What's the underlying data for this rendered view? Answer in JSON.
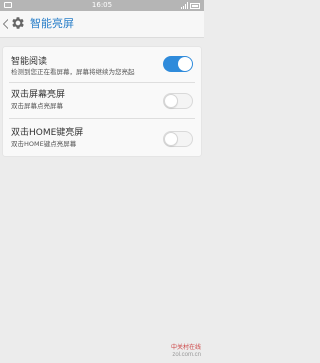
{
  "status_bar": {
    "time": "16:05"
  },
  "header": {
    "title": "智能亮屏"
  },
  "settings": [
    {
      "title": "智能阅读",
      "subtitle": "检测到您正在看屏幕，屏幕将继续为您亮起",
      "enabled": true
    },
    {
      "title": "双击屏幕亮屏",
      "subtitle": "双击屏幕点亮屏幕",
      "enabled": false
    },
    {
      "title": "双击HOME键亮屏",
      "subtitle": "双击HOME键点亮屏幕",
      "enabled": false
    }
  ],
  "watermark": {
    "line1": "中关村在线",
    "line2": "zol.com.cn"
  },
  "colors": {
    "accent": "#2f8bdb",
    "title_text": "#2a7fc9",
    "status_bar": "#b5b5b5",
    "background": "#ececec"
  },
  "icons": {
    "back": "chevron-left-icon",
    "settings": "gear-icon"
  }
}
